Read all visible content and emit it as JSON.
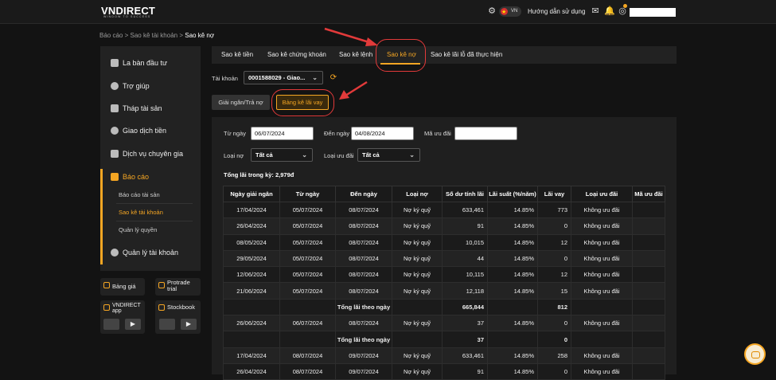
{
  "header": {
    "logo": "VNDIRECT",
    "logo_sub": "WINDOW TO SUCCESS",
    "lang": "VN",
    "guide": "Hướng dẫn sử dụng"
  },
  "breadcrumb": [
    "Báo cáo",
    "Sao kê tài khoản",
    "Sao kê nợ"
  ],
  "sidebar": {
    "items": [
      {
        "label": "La bàn đầu tư"
      },
      {
        "label": "Trợ giúp"
      },
      {
        "label": "Tháp tài sản"
      },
      {
        "label": "Giao dịch tiền"
      },
      {
        "label": "Dịch vụ chuyên gia"
      },
      {
        "label": "Báo cáo"
      },
      {
        "label": "Quản lý tài khoản"
      }
    ],
    "sub_items": [
      "Báo cáo tài sản",
      "Sao kê tài khoản",
      "Quản lý quyền"
    ],
    "cards": [
      "Bảng giá",
      "Protrade trial",
      "VNDIRECT app",
      "Stockbook"
    ]
  },
  "tabs": [
    "Sao kê tiền",
    "Sao kê chứng khoán",
    "Sao kê lệnh",
    "Sao kê nợ",
    "Sao kê lãi lỗ đã thực hiện"
  ],
  "account": {
    "label": "Tài khoản",
    "value": "0001588029 - Giao..."
  },
  "subtabs": [
    "Giải ngân/Trả nợ",
    "Bảng kê lãi vay"
  ],
  "filters": {
    "from_label": "Từ ngày",
    "from_value": "06/07/2024",
    "to_label": "Đến ngày",
    "to_value": "04/08/2024",
    "promo_label": "Mã ưu đãi",
    "promo_value": "",
    "debt_type_label": "Loại nợ",
    "debt_type_value": "Tất cả",
    "promo_type_label": "Loại ưu đãi",
    "promo_type_value": "Tất cả"
  },
  "total_interest": "Tổng lãi trong kỳ: 2,979đ",
  "table": {
    "headers": [
      "Ngày giải ngân",
      "Từ ngày",
      "Đến ngày",
      "Loại nợ",
      "Số dư tính lãi",
      "Lãi suất (%/năm)",
      "Lãi vay",
      "Loại ưu đãi",
      "Mã ưu đãi"
    ],
    "rows": [
      [
        "17/04/2024",
        "05/07/2024",
        "08/07/2024",
        "Nợ ký quỹ",
        "633,461",
        "14.85%",
        "773",
        "Không ưu đãi",
        ""
      ],
      [
        "26/04/2024",
        "05/07/2024",
        "08/07/2024",
        "Nợ ký quỹ",
        "91",
        "14.85%",
        "0",
        "Không ưu đãi",
        ""
      ],
      [
        "08/05/2024",
        "05/07/2024",
        "08/07/2024",
        "Nợ ký quỹ",
        "10,015",
        "14.85%",
        "12",
        "Không ưu đãi",
        ""
      ],
      [
        "29/05/2024",
        "05/07/2024",
        "08/07/2024",
        "Nợ ký quỹ",
        "44",
        "14.85%",
        "0",
        "Không ưu đãi",
        ""
      ],
      [
        "12/06/2024",
        "05/07/2024",
        "08/07/2024",
        "Nợ ký quỹ",
        "10,115",
        "14.85%",
        "12",
        "Không ưu đãi",
        ""
      ],
      [
        "21/06/2024",
        "05/07/2024",
        "08/07/2024",
        "Nợ ký quỹ",
        "12,118",
        "14.85%",
        "15",
        "Không ưu đãi",
        ""
      ],
      [
        "",
        "",
        "Tổng lãi theo ngày",
        "",
        "665,844",
        "",
        "812",
        "",
        ""
      ],
      [
        "26/06/2024",
        "06/07/2024",
        "08/07/2024",
        "Nợ ký quỹ",
        "37",
        "14.85%",
        "0",
        "Không ưu đãi",
        ""
      ],
      [
        "",
        "",
        "Tổng lãi theo ngày",
        "",
        "37",
        "",
        "0",
        "",
        ""
      ],
      [
        "17/04/2024",
        "08/07/2024",
        "09/07/2024",
        "Nợ ký quỹ",
        "633,461",
        "14.85%",
        "258",
        "Không ưu đãi",
        ""
      ],
      [
        "26/04/2024",
        "08/07/2024",
        "09/07/2024",
        "Nợ ký quỹ",
        "91",
        "14.85%",
        "0",
        "Không ưu đãi",
        ""
      ]
    ]
  },
  "colors": {
    "accent": "#f5a623",
    "annotation": "#e23a3a"
  }
}
